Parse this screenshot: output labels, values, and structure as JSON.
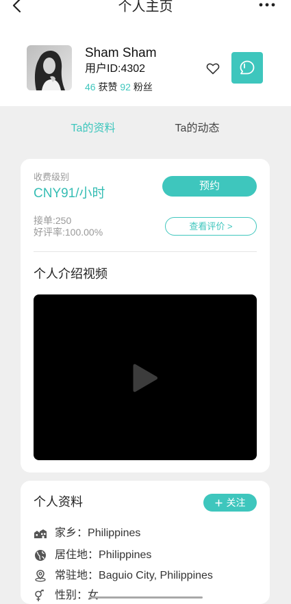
{
  "theme": {
    "accent": "#3ec6bd",
    "background": "#efefef",
    "card": "#ffffff",
    "text": "#222222",
    "muted": "#999999"
  },
  "header": {
    "title": "个人主页",
    "back_icon": "chevron-left-icon",
    "more_icon": "more-dots-icon"
  },
  "profile": {
    "avatar": "avatar-photo",
    "name": "Sham Sham",
    "user_id": "用户ID:4302",
    "likes_count": "46",
    "likes_label": "获赞",
    "fans_count": "92",
    "fans_label": "粉丝",
    "favorite_icon": "heart-outline-icon",
    "chat_icon": "chat-bubble-icon"
  },
  "tabs": [
    {
      "label": "Ta的资料",
      "active": true
    },
    {
      "label": "Ta的动态",
      "active": false
    }
  ],
  "pricing": {
    "label": "收费级别",
    "price": "CNY91/小时",
    "book_button": "预约",
    "orders": "接单:250",
    "rating": "好评率:100.00%",
    "reviews_button": "查看评价 >"
  },
  "video": {
    "title": "个人介绍视频",
    "play_icon": "play-icon"
  },
  "info": {
    "title": "个人资料",
    "follow_icon": "plus-icon",
    "follow_button": "关注",
    "rows": [
      {
        "icon": "hometown-icon",
        "label": "家乡：",
        "value": "Philippines"
      },
      {
        "icon": "globe-icon",
        "label": "居住地：",
        "value": "Philippines"
      },
      {
        "icon": "location-pin-icon",
        "label": "常驻地：",
        "value": "Baguio City, Philippines"
      },
      {
        "icon": "gender-icon",
        "label": "性别：",
        "value": "女"
      }
    ]
  }
}
